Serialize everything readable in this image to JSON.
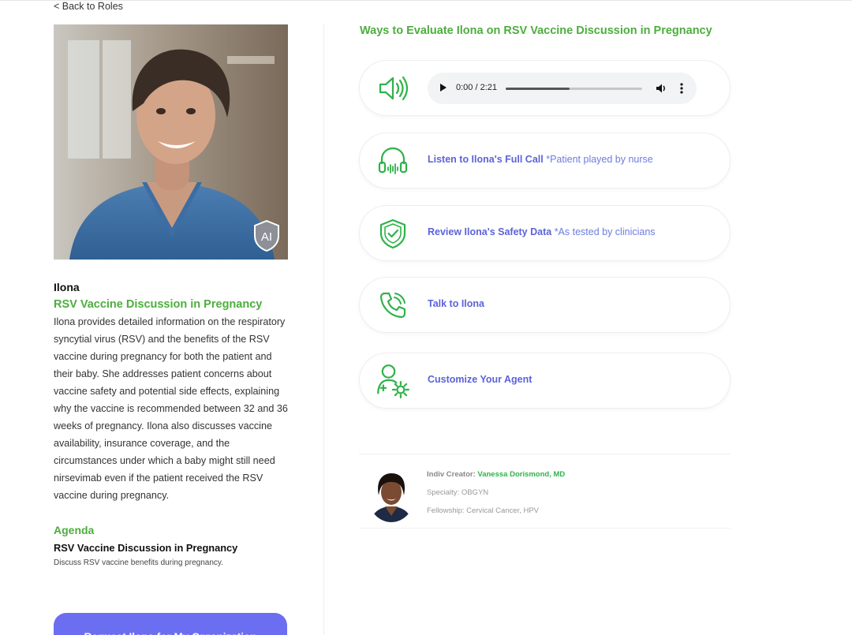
{
  "nav": {
    "back_label": "< Back to Roles"
  },
  "agent": {
    "name": "Ilona",
    "role": "RSV Vaccine Discussion in Pregnancy",
    "description": "Ilona provides detailed information on the respiratory syncytial virus (RSV) and the benefits of the RSV vaccine during pregnancy for both the patient and their baby. She addresses patient concerns about vaccine safety and potential side effects, explaining why the vaccine is recommended between 32 and 36 weeks of pregnancy. Ilona also discusses vaccine availability, insurance coverage, and the circumstances under which a baby might still need nirsevimab even if the patient received the RSV vaccine during pregnancy.",
    "badge": "AI"
  },
  "agenda": {
    "title": "Agenda",
    "item_title": "RSV Vaccine Discussion in Pregnancy",
    "item_desc": "Discuss RSV vaccine benefits during pregnancy."
  },
  "cta": {
    "request_label": "Request Ilona for My Organization"
  },
  "evaluate": {
    "title": "Ways to Evaluate Ilona on RSV Vaccine Discussion in Pregnancy",
    "audio": {
      "time": "0:00 / 2:21",
      "progress": 0.47
    },
    "cards": [
      {
        "icon": "headset-icon",
        "label": "Listen to Ilona's Full Call",
        "note": "*Patient played by nurse"
      },
      {
        "icon": "shield-check-icon",
        "label": "Review Ilona's Safety Data",
        "note": "*As tested by clinicians"
      },
      {
        "icon": "phone-icon",
        "label": "Talk to Ilona",
        "note": ""
      },
      {
        "icon": "user-gear-icon",
        "label": "Customize Your Agent",
        "note": ""
      }
    ]
  },
  "creator": {
    "prefix": "Indiv Creator:",
    "name": "Vanessa Dorismond, MD",
    "specialty": "Specialty: OBGYN",
    "fellowship": "Fellowship: Cervical Cancer, HPV"
  },
  "colors": {
    "accent_green": "#4cae3d",
    "accent_purple": "#6b6ef0",
    "link_blue": "#5b63d8",
    "icon_green": "#2fb24a"
  }
}
